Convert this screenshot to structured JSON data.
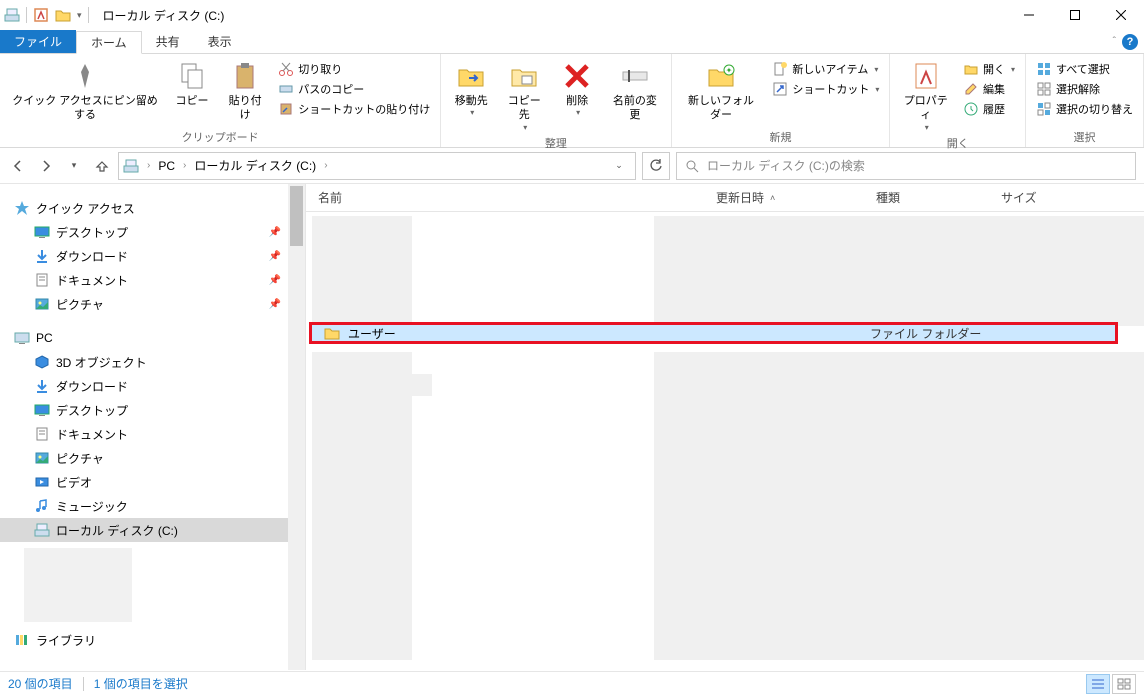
{
  "window": {
    "title": "ローカル ディスク (C:)"
  },
  "tabs": {
    "file": "ファイル",
    "home": "ホーム",
    "share": "共有",
    "view": "表示"
  },
  "ribbon": {
    "clipboard": {
      "pin": "クイック アクセスにピン留めする",
      "copy": "コピー",
      "paste": "貼り付け",
      "cut": "切り取り",
      "copypath": "パスのコピー",
      "pasteshortcut": "ショートカットの貼り付け",
      "label": "クリップボード"
    },
    "organize": {
      "moveto": "移動先",
      "copyto": "コピー先",
      "delete": "削除",
      "rename": "名前の変更",
      "label": "整理"
    },
    "new": {
      "newfolder": "新しいフォルダー",
      "newitem": "新しいアイテム",
      "shortcut": "ショートカット",
      "label": "新規"
    },
    "open": {
      "properties": "プロパティ",
      "open": "開く",
      "edit": "編集",
      "history": "履歴",
      "label": "開く"
    },
    "select": {
      "selectall": "すべて選択",
      "selectnone": "選択解除",
      "invert": "選択の切り替え",
      "label": "選択"
    }
  },
  "breadcrumb": {
    "pc": "PC",
    "drive": "ローカル ディスク (C:)"
  },
  "search": {
    "placeholder": "ローカル ディスク (C:)の検索"
  },
  "sidebar": {
    "quickaccess": "クイック アクセス",
    "desktop": "デスクトップ",
    "downloads": "ダウンロード",
    "documents": "ドキュメント",
    "pictures": "ピクチャ",
    "pc": "PC",
    "objects3d": "3D オブジェクト",
    "downloads2": "ダウンロード",
    "desktop2": "デスクトップ",
    "documents2": "ドキュメント",
    "pictures2": "ピクチャ",
    "videos": "ビデオ",
    "music": "ミュージック",
    "localdisk": "ローカル ディスク (C:)",
    "libraries": "ライブラリ"
  },
  "columns": {
    "name": "名前",
    "date": "更新日時",
    "type": "種類",
    "size": "サイズ"
  },
  "selected_item": {
    "name": "ユーザー",
    "type": "ファイル フォルダー"
  },
  "statusbar": {
    "count": "20 個の項目",
    "selected": "1 個の項目を選択"
  }
}
